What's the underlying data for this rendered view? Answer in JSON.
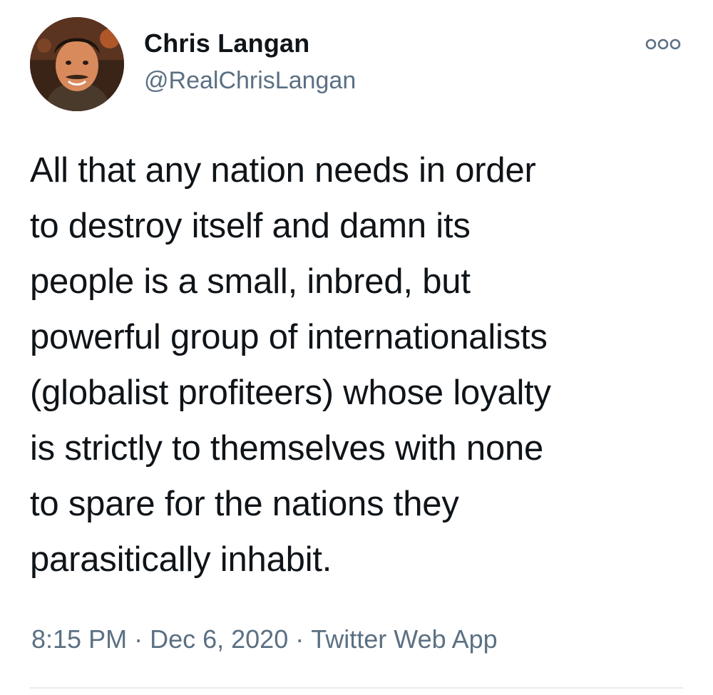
{
  "tweet": {
    "author": {
      "display_name": "Chris Langan",
      "handle": "@RealChrisLangan",
      "avatar_icon": "profile-photo"
    },
    "more_icon": "more-options-icon",
    "text_lines": [
      "All that any nation needs in order",
      "to destroy itself and damn its",
      "people is a small, inbred, but",
      "powerful group of internationalists",
      "(globalist profiteers) whose loyalty",
      "is strictly to themselves with none",
      "to spare for the nations they",
      "parasitically inhabit."
    ],
    "time": "8:15 PM",
    "separator": "·",
    "date": "Dec 6, 2020",
    "source": "Twitter Web App"
  },
  "colors": {
    "text": "#0f1419",
    "secondary": "#5b7083",
    "divider": "#e6ecf0",
    "background": "#ffffff"
  }
}
